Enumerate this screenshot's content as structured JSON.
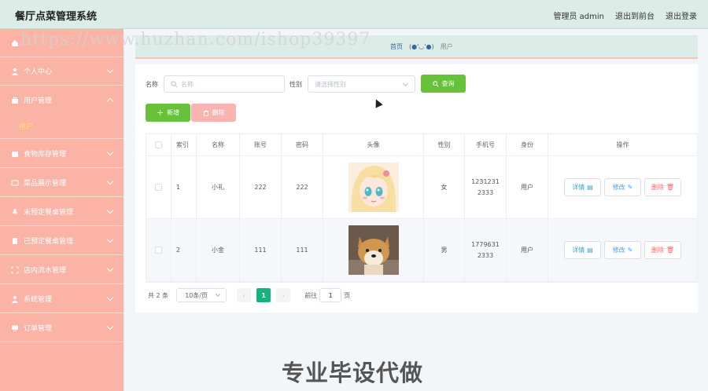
{
  "header": {
    "app_title": "餐厅点菜管理系统",
    "admin_label": "管理员 admin",
    "back_front": "退出到前台",
    "logout": "退出登录"
  },
  "sidebar": {
    "items": [
      {
        "label": "个人中心",
        "icon": "user-icon"
      },
      {
        "label": "用户管理",
        "icon": "briefcase-icon",
        "expanded": true
      },
      {
        "label": "食物库存管理",
        "icon": "box-icon"
      },
      {
        "label": "菜品展示管理",
        "icon": "chat-icon"
      },
      {
        "label": "未预定餐桌管理",
        "icon": "mic-icon"
      },
      {
        "label": "已预定餐桌管理",
        "icon": "clipboard-icon"
      },
      {
        "label": "店内流水管理",
        "icon": "expand-icon"
      },
      {
        "label": "系统管理",
        "icon": "user-icon"
      },
      {
        "label": "订单管理",
        "icon": "monitor-icon"
      }
    ],
    "sub_item": "用户"
  },
  "breadcrumb": {
    "home": "首页",
    "face": "(●'◡'●)",
    "current": "用户"
  },
  "search": {
    "name_label": "名称",
    "name_placeholder": "名称",
    "gender_label": "性别",
    "gender_placeholder": "请选择性别",
    "search_button": "查询"
  },
  "actions": {
    "add": "新增",
    "delete": "删除"
  },
  "table": {
    "headers": [
      "索引",
      "名称",
      "账号",
      "密码",
      "头像",
      "性别",
      "手机号",
      "身份",
      "操作"
    ],
    "rows": [
      {
        "index": "1",
        "name": "小礼",
        "account": "222",
        "password": "222",
        "gender": "女",
        "phone": "12312312333",
        "role": "用户"
      },
      {
        "index": "2",
        "name": "小金",
        "account": "111",
        "password": "111",
        "gender": "男",
        "phone": "17796312333",
        "role": "用户"
      }
    ],
    "op_detail": "详情",
    "op_edit": "修改",
    "op_delete": "删除"
  },
  "pagination": {
    "total": "共 2 条",
    "page_size": "10条/页",
    "current_page": "1",
    "goto_label": "前往",
    "goto_value": "1",
    "page_unit": "页"
  },
  "watermark": {
    "url": "https://www.huzhan.com/ishop39397",
    "bottom": "专业毕设代做"
  },
  "colors": {
    "sidebar": "#fbb3a6",
    "header": "#dcece6",
    "accent_green": "#67c23a",
    "page_active": "#18b27d"
  }
}
